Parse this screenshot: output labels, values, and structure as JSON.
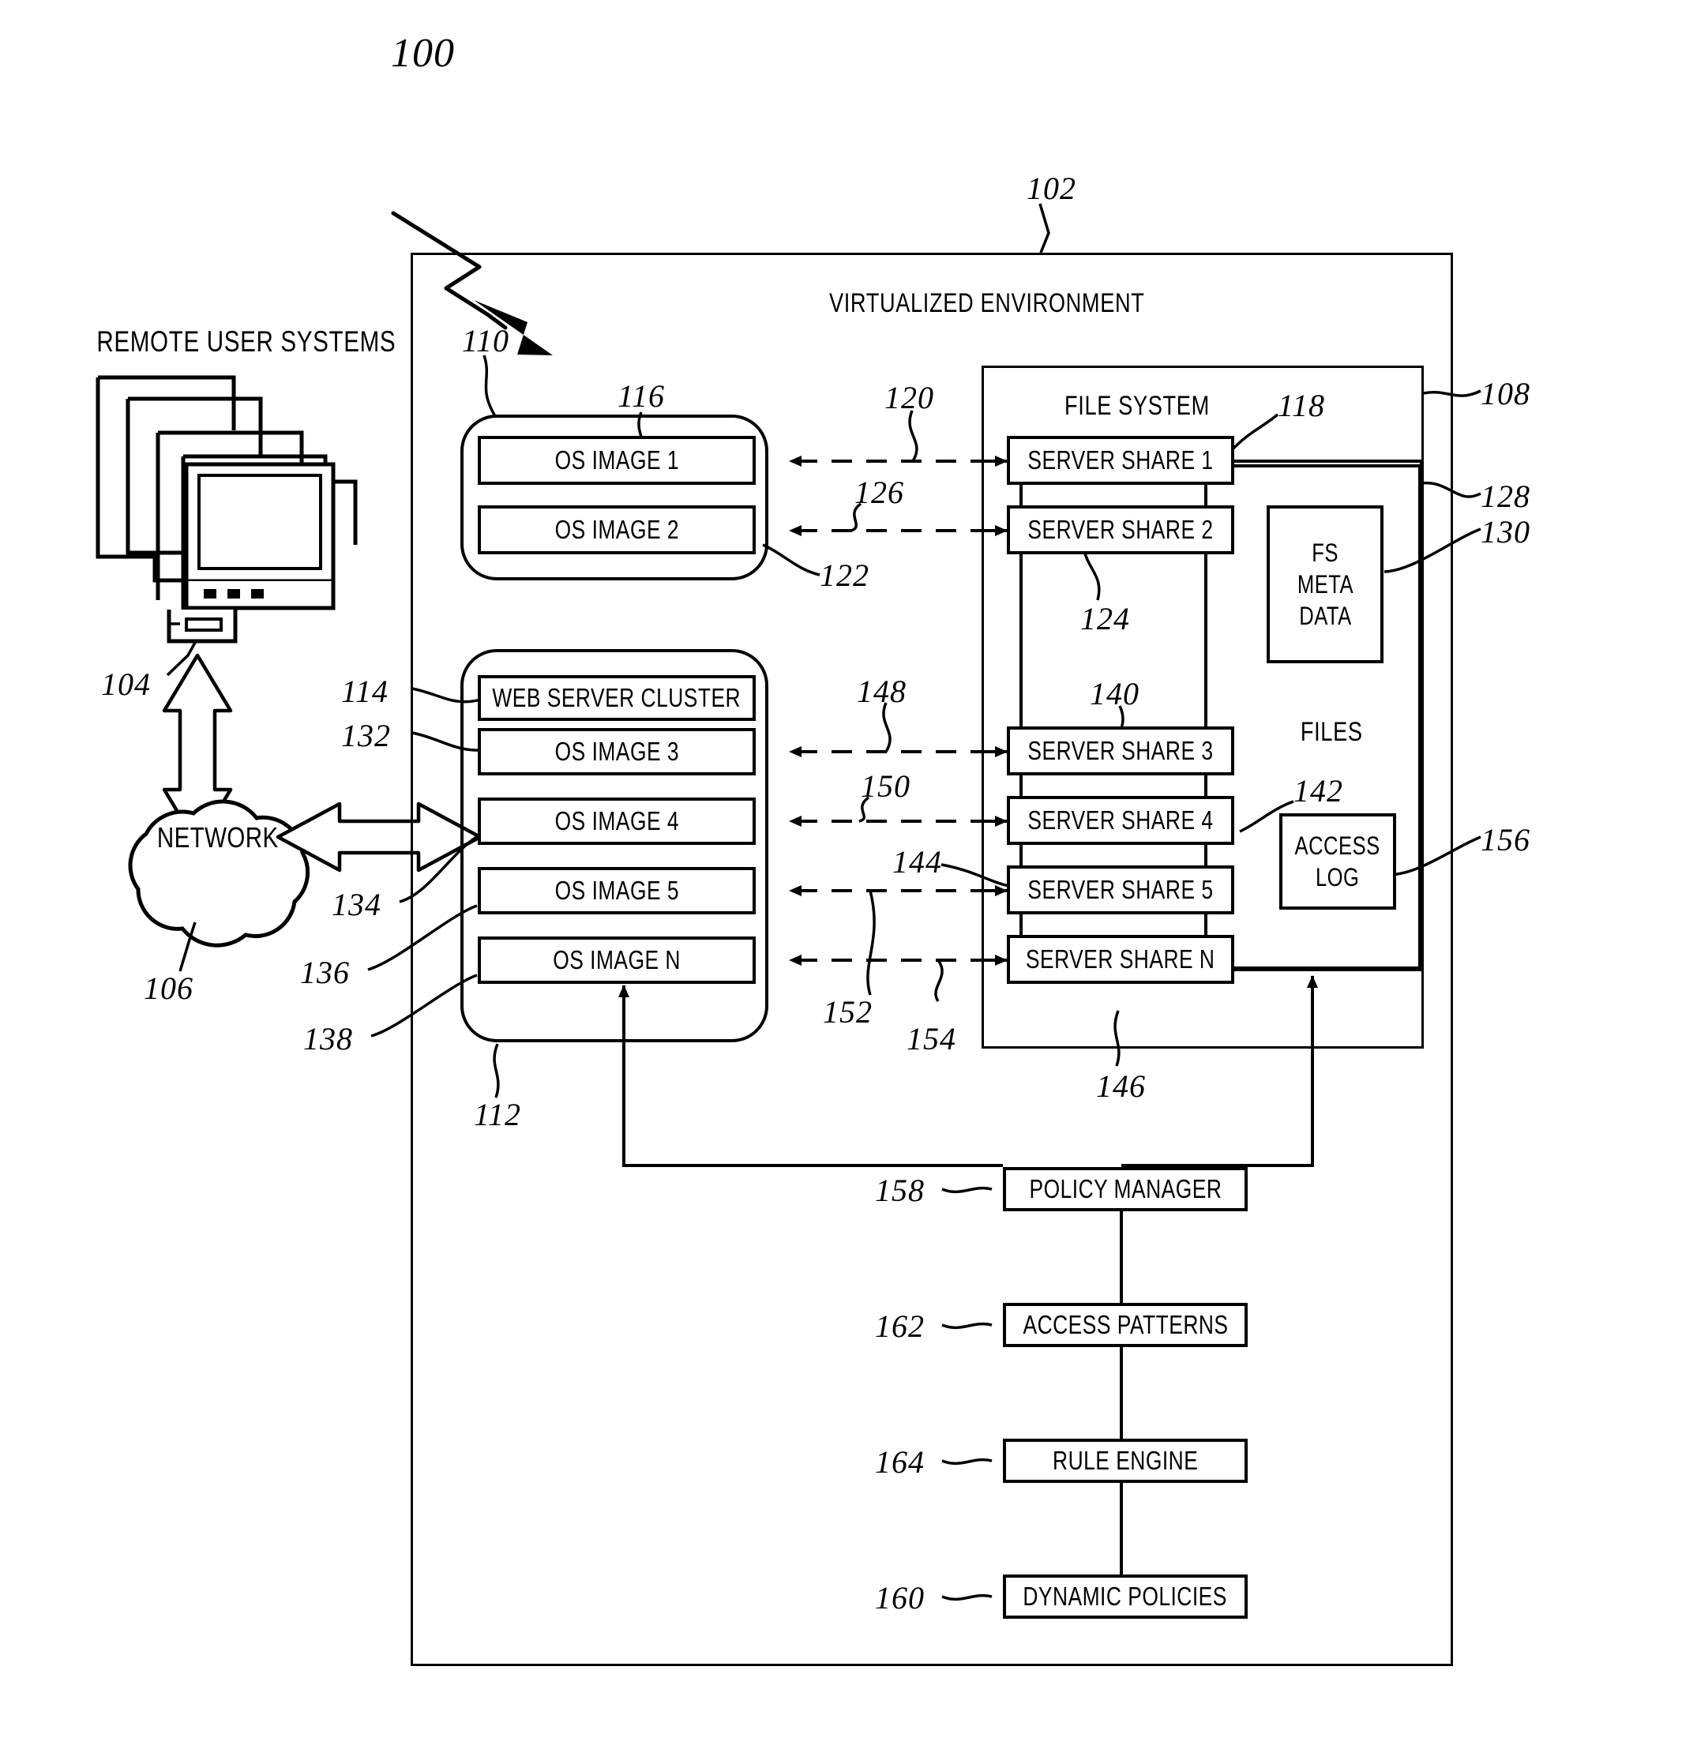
{
  "figure": {
    "number": "100"
  },
  "left": {
    "heading": "REMOTE USER SYSTEMS",
    "ref_user_systems": "104",
    "network_label": "NETWORK",
    "ref_network": "106"
  },
  "environment": {
    "title": "VIRTUALIZED ENVIRONMENT",
    "ref": "102"
  },
  "file_system": {
    "title": "FILE SYSTEM",
    "ref_file_system": "108",
    "files_label": "FILES",
    "ref_files": "128",
    "ref_fs_meta_data": "130",
    "ref_access_log": "156",
    "fs_meta_data_label": "FS META DATA",
    "fs_meta_data_lines": [
      "FS",
      "META",
      "DATA"
    ],
    "access_log_label": "ACCESS LOG",
    "access_log_lines": [
      "ACCESS",
      "LOG"
    ]
  },
  "group_top": {
    "ref": "110"
  },
  "group_bottom": {
    "ref": "112"
  },
  "os_images": [
    {
      "label": "OS IMAGE 1",
      "ref": "116"
    },
    {
      "label": "OS IMAGE 2",
      "ref": "122"
    },
    {
      "label": "WEB SERVER CLUSTER",
      "ref": "114"
    },
    {
      "label": "OS IMAGE 3",
      "ref": "132"
    },
    {
      "label": "OS IMAGE 4",
      "ref": "134"
    },
    {
      "label": "OS IMAGE 5",
      "ref": "136"
    },
    {
      "label": "OS IMAGE N",
      "ref": "138"
    }
  ],
  "server_shares": [
    {
      "label": "SERVER SHARE 1",
      "ref": "118"
    },
    {
      "label": "SERVER SHARE 2",
      "ref": "124"
    },
    {
      "label": "SERVER SHARE 3",
      "ref": "140"
    },
    {
      "label": "SERVER SHARE 4",
      "ref": "142"
    },
    {
      "label": "SERVER SHARE 5",
      "ref": "144"
    },
    {
      "label": "SERVER SHARE N",
      "ref": "146"
    }
  ],
  "links": {
    "ref_120": "120",
    "ref_126": "126",
    "ref_148": "148",
    "ref_150": "150",
    "ref_152": "152",
    "ref_154": "154"
  },
  "policy_chain": [
    {
      "label": "POLICY MANAGER",
      "ref": "158"
    },
    {
      "label": "ACCESS PATTERNS",
      "ref": "162"
    },
    {
      "label": "RULE ENGINE",
      "ref": "164"
    },
    {
      "label": "DYNAMIC POLICIES",
      "ref": "160"
    }
  ],
  "colors": {
    "ink": "#000000",
    "paper": "#ffffff"
  }
}
